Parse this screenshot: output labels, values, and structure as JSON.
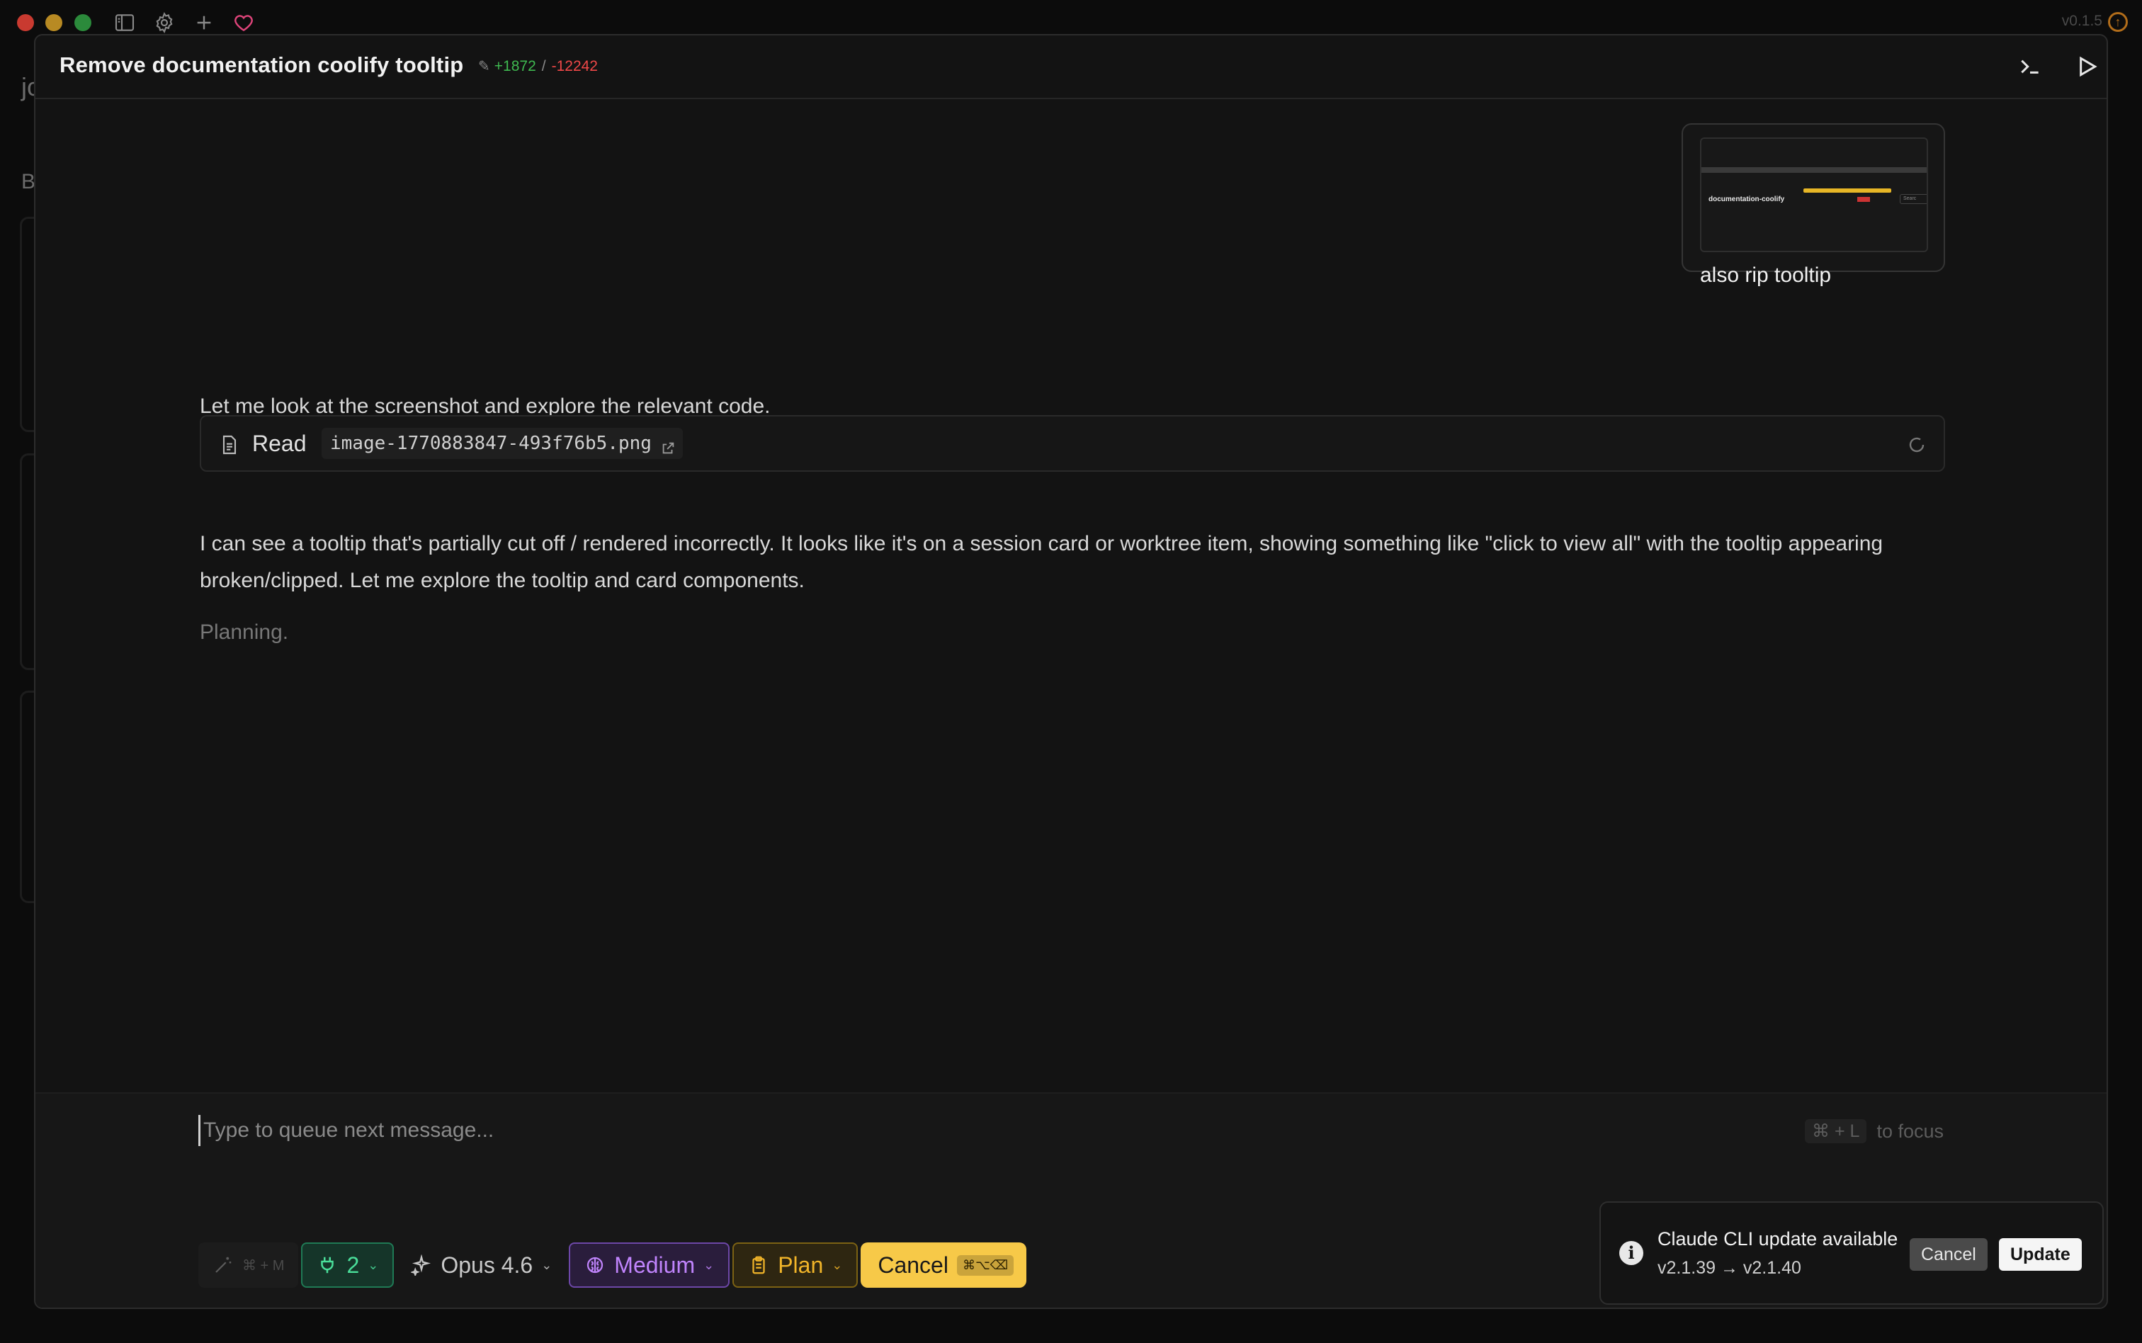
{
  "window": {
    "version": "v0.1.5",
    "accent_colors": {
      "close": "#c93a30",
      "minimize": "#b88a23",
      "maximize": "#2b8a3b"
    },
    "toolbar_icons": [
      "sidebar-icon",
      "gear-icon",
      "plus-icon",
      "heart-icon"
    ]
  },
  "background_page": {
    "letter_top": "jc",
    "letter_side": "B"
  },
  "session": {
    "title": "Remove documentation coolify tooltip",
    "additions": "+1872",
    "separator": "/",
    "deletions": "-12242",
    "header_buttons": [
      "terminal-icon",
      "play-icon"
    ]
  },
  "user_message": {
    "text": "also rip tooltip",
    "thumbnail": {
      "caption": "documentation-coolify",
      "search": "Searc"
    }
  },
  "assistant": {
    "intro": "Let me look at the screenshot and explore the relevant code.",
    "tool_call": {
      "label": "Read",
      "path": "image-1770883847-493f76b5.png"
    },
    "observation": "I can see a tooltip that's partially cut off / rendered incorrectly. It looks like it's on a session card or worktree item, showing something like \"click to view all\" with the tooltip appearing broken/clipped. Let me explore the tooltip and card components.",
    "status": "Planning."
  },
  "composer": {
    "placeholder": "Type to queue next message...",
    "focus_shortcut": "⌘ + L",
    "focus_label": "to focus",
    "magic_shortcut": "⌘ + M",
    "branch_count": "2",
    "model": "Opus 4.6",
    "effort": "Medium",
    "mode": "Plan",
    "cancel_label": "Cancel",
    "cancel_shortcut": "⌘⌥⌫",
    "colors": {
      "branch": "#4ade9a",
      "effort": "#c084fc",
      "plan": "#f0b429",
      "cancel_bg": "#f7c948"
    }
  },
  "toast": {
    "title": "Claude CLI update available",
    "subtitle": "v2.1.39 → v2.1.40",
    "cancel_label": "Cancel",
    "update_label": "Update"
  }
}
